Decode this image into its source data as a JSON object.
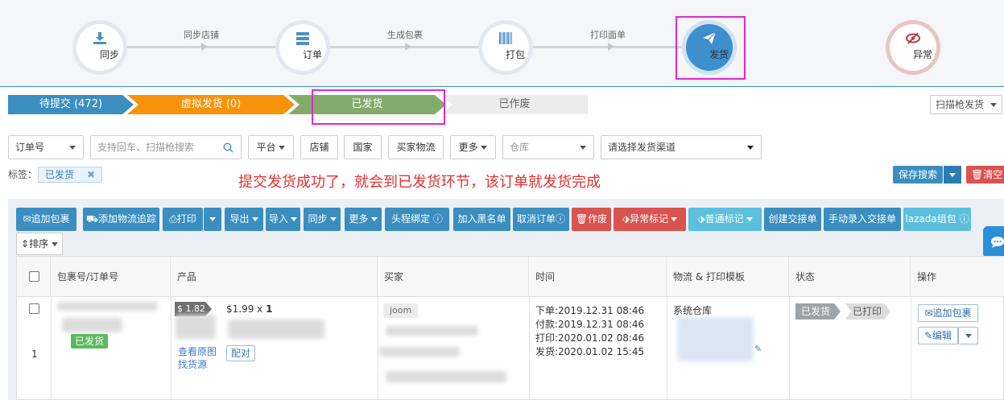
{
  "workflow": {
    "steps": [
      {
        "label": "同步",
        "icon": "download-icon"
      },
      {
        "label": "订单",
        "icon": "server-icon"
      },
      {
        "label": "打包",
        "icon": "barcode-icon"
      },
      {
        "label": "发货",
        "icon": "paper-plane-icon"
      },
      {
        "label": "异常",
        "icon": "eye-slash-icon"
      }
    ],
    "connectors": [
      "同步店铺",
      "生成包裹",
      "打印面单"
    ]
  },
  "status_tabs": [
    {
      "label": "待提交 (472)"
    },
    {
      "label": "虚拟发货 (0)"
    },
    {
      "label": "已发货"
    },
    {
      "label": "已作废"
    }
  ],
  "scan_ship": {
    "label": "扫描枪发货"
  },
  "filters": {
    "order_no": "订单号",
    "search_placeholder": "支持回车、扫描枪搜索",
    "platform": "平台",
    "shop": "店铺",
    "country": "国家",
    "buyer_logistics": "买家物流",
    "more": "更多",
    "warehouse": "仓库",
    "channel": "请选择发货渠道"
  },
  "tags": {
    "label": "标签：",
    "chip": "已发货",
    "chip_close": "✖"
  },
  "annotation": "提交发货成功了，就会到已发货环节，该订单就发货完成",
  "search_actions": {
    "save": "保存搜索",
    "clear": "清空"
  },
  "toolbar": {
    "buttons": [
      "追加包裹",
      "添加物流追踪",
      "打印",
      "导出",
      "导入",
      "同步",
      "更多",
      "头程绑定",
      "加入黑名单",
      "取消订单",
      "作废",
      "异常标记",
      "普通标记",
      "创建交接单",
      "手动录入交接单",
      "lazada组包"
    ],
    "sort": "排序"
  },
  "table": {
    "headers": [
      "包裹号/订单号",
      "产品",
      "买家",
      "时间",
      "物流 & 打印模板",
      "状态",
      "操作"
    ],
    "rows": [
      {
        "index": "1",
        "status_label": "已发货",
        "price_tag": "$ 1.82",
        "unit_price": "$1.99 x",
        "qty": "1",
        "view_image": "查看原图",
        "find_source": "找货源",
        "pair": "配对",
        "platform": "joom",
        "times": [
          "下单:2019.12.31 08:46",
          "付款:2019.12.31 08:46",
          "打印:2020.01.02 08:46",
          "发货:2020.01.02 15:45"
        ],
        "warehouse": "系统仓库",
        "statuses": [
          "已发货",
          "已打印"
        ],
        "ops": [
          "追加包裹",
          "编辑"
        ]
      }
    ]
  }
}
